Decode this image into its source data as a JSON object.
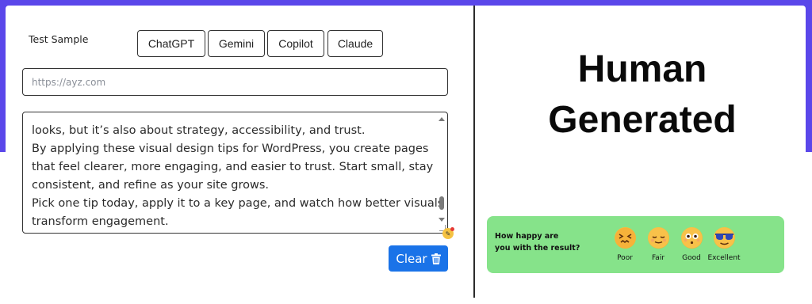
{
  "sample": {
    "label": "Test Sample"
  },
  "models": [
    "ChatGPT",
    "Gemini",
    "Copilot",
    "Claude"
  ],
  "url_input": {
    "placeholder": "https://ayz.com",
    "value": ""
  },
  "text_input": {
    "lines": [
      "looks, but it’s also about strategy, accessibility, and trust.",
      "By applying these visual design tips for WordPress, you create pages",
      "that feel clearer, more engaging, and easier to trust. Start small, stay",
      "consistent, and refine as your site grows.",
      "Pick one tip today, apply it to a key page, and watch how better visuals",
      "transform engagement."
    ]
  },
  "clear_button": {
    "label": "Clear",
    "icon": "trash-icon"
  },
  "result": {
    "line1": "Human",
    "line2": "Generated"
  },
  "feedback": {
    "question_line1": "How happy are",
    "question_line2": "you with the result?",
    "ratings": [
      {
        "label": "Poor",
        "icon": "confounded-face-icon"
      },
      {
        "label": "Fair",
        "icon": "relieved-face-icon"
      },
      {
        "label": "Good",
        "icon": "flushed-face-icon"
      },
      {
        "label": "Excellent",
        "icon": "sunglasses-face-icon"
      }
    ]
  },
  "colors": {
    "background_top": "#5a47ea",
    "clear_button": "#1a73e8",
    "feedback_panel": "#86e38a"
  }
}
